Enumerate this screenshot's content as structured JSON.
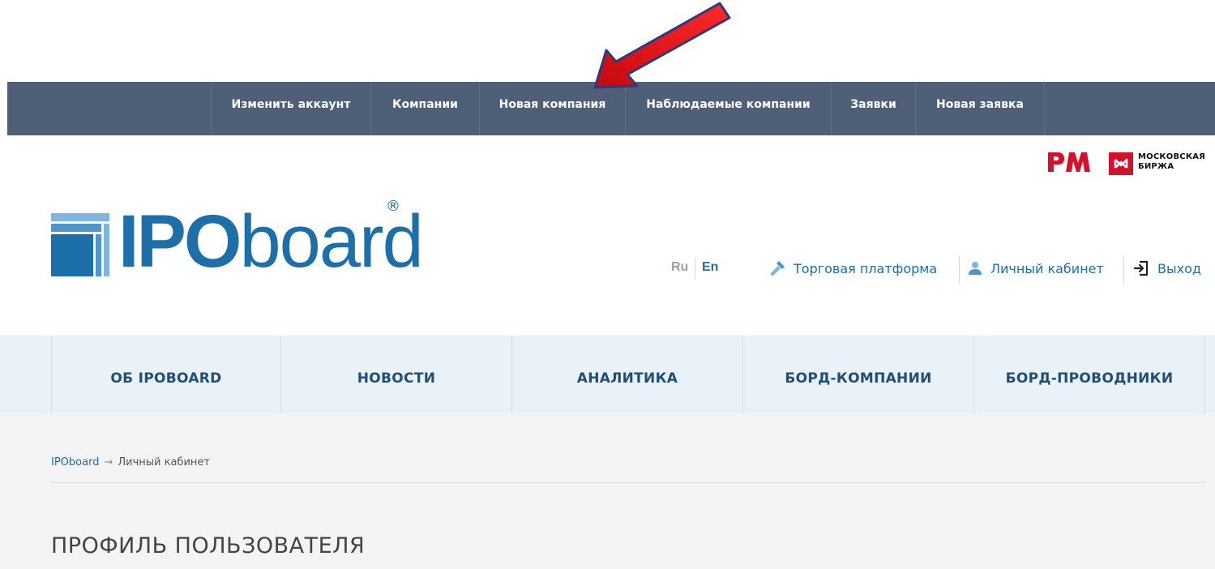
{
  "admin_bar": {
    "items": [
      {
        "label": "Изменить аккаунт"
      },
      {
        "label": "Компании"
      },
      {
        "label": "Новая компания"
      },
      {
        "label": "Наблюдаемые компании"
      },
      {
        "label": "Заявки"
      },
      {
        "label": "Новая заявка"
      }
    ]
  },
  "partners": {
    "moex_line1": "МОСКОВСКАЯ",
    "moex_line2": "БИРЖА"
  },
  "brand": {
    "ipo": "IPO",
    "board": "board",
    "reg": "®"
  },
  "header": {
    "lang_ru": "Ru",
    "lang_en": "En",
    "trading_platform": "Торговая платформа",
    "personal_cabinet": "Личный кабинет",
    "logout": "Выход"
  },
  "main_nav": {
    "items": [
      {
        "label": "ОБ IPOBOARD"
      },
      {
        "label": "НОВОСТИ"
      },
      {
        "label": "АНАЛИТИКА"
      },
      {
        "label": "БОРД-КОМПАНИИ"
      },
      {
        "label": "БОРД-ПРОВОДНИКИ"
      }
    ]
  },
  "breadcrumb": {
    "home": "IPOboard",
    "arrow": "→",
    "current": "Личный кабинет"
  },
  "page": {
    "title": "ПРОФИЛЬ ПОЛЬЗОВАТЕЛЯ"
  },
  "colors": {
    "admin_bar_bg": "#4f5f78",
    "brand_blue": "#1c6fa9",
    "nav_bg": "#e9f1f9",
    "nav_text": "#1f4e78",
    "annotation_red": "#e8141b",
    "moex_red": "#d6102b"
  }
}
